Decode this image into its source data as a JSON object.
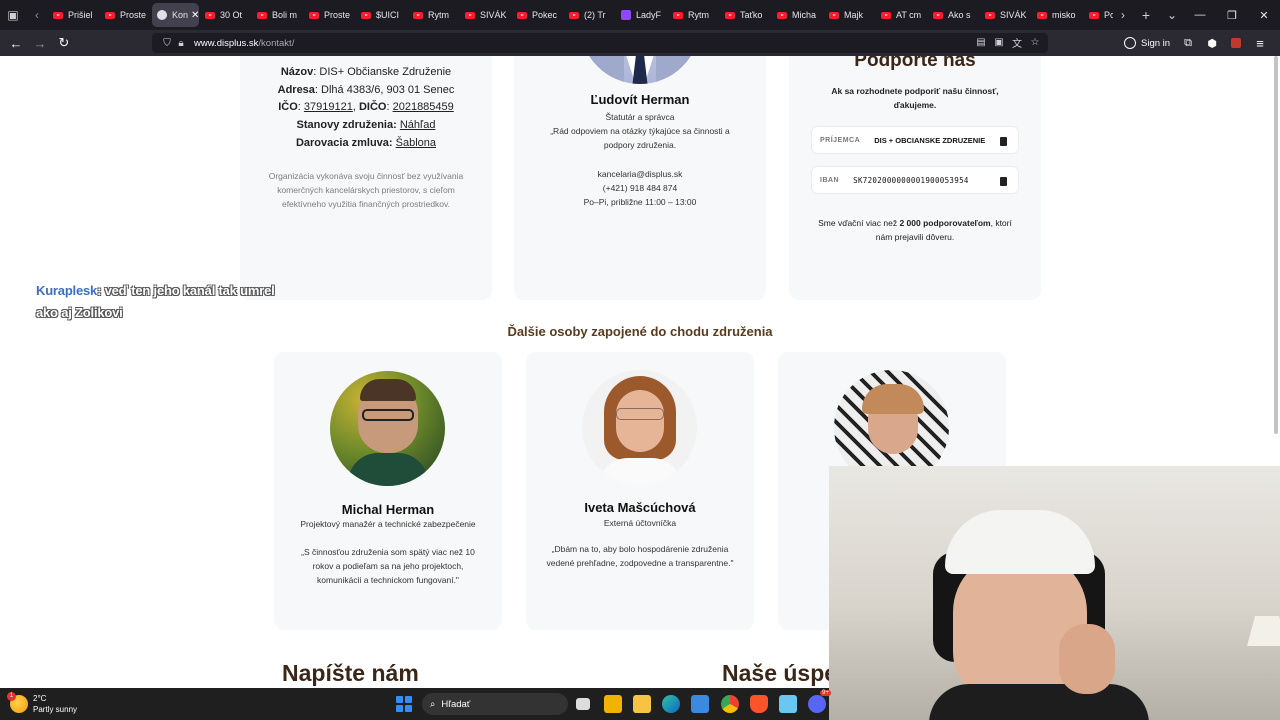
{
  "browser": {
    "tabs": [
      {
        "label": "Prišiel",
        "kind": "yt"
      },
      {
        "label": "Proste",
        "kind": "yt"
      },
      {
        "label": "Kon",
        "kind": "globe",
        "active": true
      },
      {
        "label": "30 Ot",
        "kind": "yt"
      },
      {
        "label": "Boli m",
        "kind": "yt"
      },
      {
        "label": "Proste",
        "kind": "yt"
      },
      {
        "label": "$UICI",
        "kind": "yt"
      },
      {
        "label": "Rytm",
        "kind": "yt"
      },
      {
        "label": "SIVÁK",
        "kind": "yt"
      },
      {
        "label": "Pokec",
        "kind": "yt"
      },
      {
        "label": "(2) Tr",
        "kind": "yt"
      },
      {
        "label": "LadyF",
        "kind": "tw"
      },
      {
        "label": "Rytm",
        "kind": "yt"
      },
      {
        "label": "Taťko",
        "kind": "yt"
      },
      {
        "label": "Micha",
        "kind": "yt"
      },
      {
        "label": "Majk",
        "kind": "yt"
      },
      {
        "label": "AT cm",
        "kind": "yt"
      },
      {
        "label": "Ako s",
        "kind": "yt"
      },
      {
        "label": "SIVÁK",
        "kind": "yt"
      },
      {
        "label": "misko",
        "kind": "yt"
      },
      {
        "label": "Po",
        "kind": "yt"
      }
    ],
    "url_domain": "www.displus.sk",
    "url_path": "/kontakt/",
    "sign_in": "Sign in"
  },
  "org": {
    "name_label": "Názov",
    "name_value": ": DIS+ Občianske Združenie",
    "address_label": "Adresa",
    "address_value": ": Dlhá 4383/6, 903 01 Senec",
    "ico_label": "IČO",
    "ico_value": "37919121",
    "dico_label": "DIČO",
    "dico_value": "2021885459",
    "statutes_label": "Stanovy združenia:",
    "statutes_link": "Náhľad",
    "donation_label": "Darovacia zmluva:",
    "donation_link": "Šablona",
    "note": "Organizácia vykonáva svoju činnosť bez využívania komerčných kancelárskych priestorov, s cieľom efektívneho využitia finančných prostriedkov."
  },
  "director": {
    "name": "Ľudovít Herman",
    "role": "Štatutár a správca",
    "quote": "„Rád odpoviem na otázky týkajúce sa činnosti a podpory združenia.",
    "email": "kancelaria@displus.sk",
    "phone": "(+421) 918 484 874",
    "hours": "Po–Pi, približne 11:00 – 13:00"
  },
  "support": {
    "title": "Podporte nás",
    "intro": "Ak sa rozhodnete podporiť našu činnosť, ďakujeme.",
    "recipient_label": "PRÍJEMCA",
    "recipient_value": "DIS + OBCIANSKE ZDRUZENIE",
    "iban_label": "IBAN",
    "iban_value": "SK7202000000001900053954",
    "thanks_pre": "Sme vďační viac než",
    "thanks_bold": "2 000 podporovateľom",
    "thanks_post": ", ktorí nám prejavili dôveru."
  },
  "chat": {
    "user": "Kuraplesk",
    "message": ": veď ten jeho kanál tak umrel ako aj Zolikovi"
  },
  "others": {
    "title": "Ďalšie osoby zapojené do chodu združenia",
    "people": [
      {
        "name": "Michal Herman",
        "role": "Projektový manažér a technické zabezpečenie",
        "quote": "„S činnosťou združenia som spätý viac než 10 rokov a podieľam sa na jeho projektoch, komunikácii a technickom fungovaní.\""
      },
      {
        "name": "Iveta Mašcúchová",
        "role": "Externá účtovníčka",
        "quote": "„Dbám na to, aby bolo hospodárenie združenia vedené prehľadne, zodpovedne a transparentne.\""
      }
    ]
  },
  "bottom": {
    "write_us": "Napíšte nám",
    "success": "Naše úspe"
  },
  "taskbar": {
    "temp": "2°C",
    "weather": "Partly sunny",
    "weather_badge": "1",
    "search": "Hľadať",
    "discord_badge": "9+"
  },
  "colors": {
    "chrome_dark": "#1c1b22",
    "toolbar": "#2b2a33",
    "card_bg": "#f7f8f9",
    "heading_brown": "#5a3b1e",
    "youtube_red": "#ff1b2d"
  }
}
